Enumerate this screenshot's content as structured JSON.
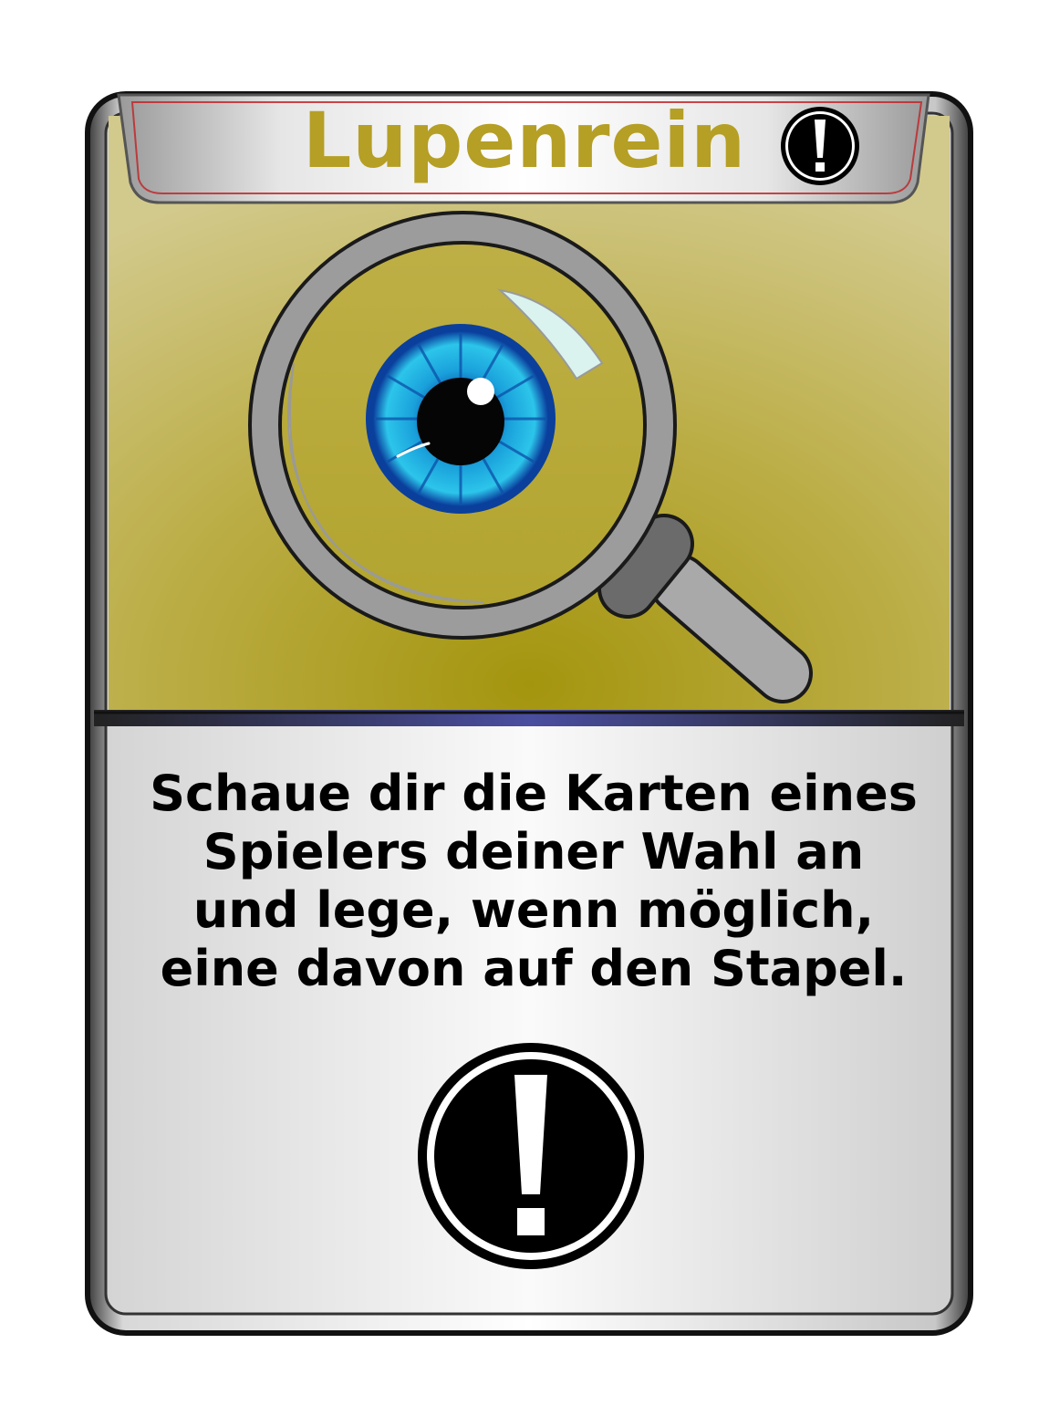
{
  "card": {
    "title": "Lupenrein",
    "text_lines": [
      "Schaue dir die Karten eines",
      "Spielers deiner Wahl an",
      "und lege, wenn möglich,",
      "eine davon auf den Stapel."
    ],
    "category_icon": "exclamation-icon",
    "illustration": "magnifying-glass-eye",
    "colors": {
      "title": "#b59f25",
      "art_background": "#b8aa3a",
      "iris": "#1ba8d8",
      "text": "#000000"
    }
  }
}
